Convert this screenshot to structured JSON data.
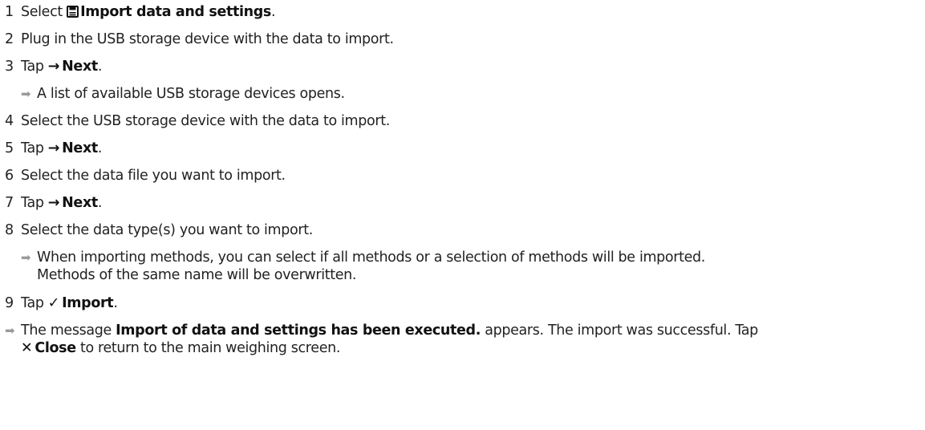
{
  "steps": [
    {
      "num": "1",
      "pre": "Select",
      "label": "Import data and settings",
      "post": "."
    },
    {
      "num": "2",
      "text": "Plug in the USB storage device with the data to import."
    },
    {
      "num": "3",
      "pre": "Tap",
      "label": "Next",
      "post": "."
    },
    {
      "result": "A list of available USB storage devices opens."
    },
    {
      "num": "4",
      "text": "Select the USB storage device with the data to import."
    },
    {
      "num": "5",
      "pre": "Tap",
      "label": "Next",
      "post": "."
    },
    {
      "num": "6",
      "text": "Select the data file you want to import."
    },
    {
      "num": "7",
      "pre": "Tap",
      "label": "Next",
      "post": "."
    },
    {
      "num": "8",
      "text": "Select the data type(s) you want to import."
    },
    {
      "result_line1": "When importing methods, you can select if all methods or a selection of methods will be imported.",
      "result_line2": "Methods of the same name will be overwritten."
    },
    {
      "num": "9",
      "pre": "Tap",
      "label": "Import",
      "post": "."
    }
  ],
  "final": {
    "pre": "The message",
    "message": "Import of data and settings has been executed.",
    "mid": "appears. The import was successful. Tap",
    "close_label": "Close",
    "post": "to return to the main weighing screen."
  },
  "icons": {
    "import": "save-disk-icon",
    "next": "right-arrow-icon",
    "check": "check-icon",
    "close": "x-close-icon",
    "result": "result-arrow-icon"
  }
}
